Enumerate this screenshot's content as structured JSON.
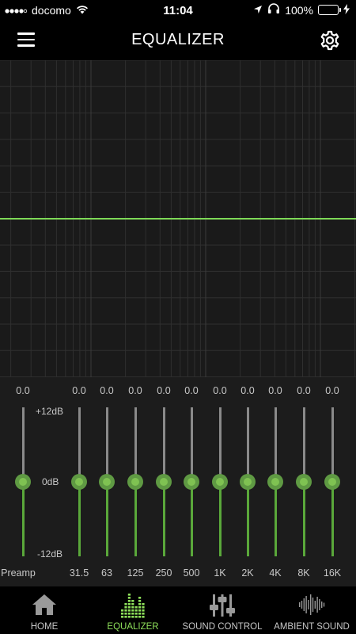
{
  "status_bar": {
    "carrier": "docomo",
    "time": "11:04",
    "battery": "100%",
    "battery_level": 1.0
  },
  "header": {
    "title": "EQUALIZER",
    "menu_icon": "hamburger-menu-icon",
    "settings_icon": "gear-icon"
  },
  "graph": {
    "curve_color": "#7ed957",
    "curve_level_db": 0
  },
  "equalizer": {
    "db_labels": {
      "top": "+12dB",
      "mid": "0dB",
      "bottom": "-12dB"
    },
    "preamp": {
      "label": "Preamp",
      "value": "0.0"
    },
    "bands": [
      {
        "label": "31.5",
        "value": "0.0"
      },
      {
        "label": "63",
        "value": "0.0"
      },
      {
        "label": "125",
        "value": "0.0"
      },
      {
        "label": "250",
        "value": "0.0"
      },
      {
        "label": "500",
        "value": "0.0"
      },
      {
        "label": "1K",
        "value": "0.0"
      },
      {
        "label": "2K",
        "value": "0.0"
      },
      {
        "label": "4K",
        "value": "0.0"
      },
      {
        "label": "8K",
        "value": "0.0"
      },
      {
        "label": "16K",
        "value": "0.0"
      }
    ],
    "accent_color": "#5aa83a"
  },
  "tabs": [
    {
      "label": "HOME",
      "icon": "home-icon",
      "active": false
    },
    {
      "label": "EQUALIZER",
      "icon": "equalizer-icon",
      "active": true
    },
    {
      "label": "SOUND CONTROL",
      "icon": "mixer-sliders-icon",
      "active": false
    },
    {
      "label": "AMBIENT SOUND",
      "icon": "waveform-icon",
      "active": false
    }
  ]
}
